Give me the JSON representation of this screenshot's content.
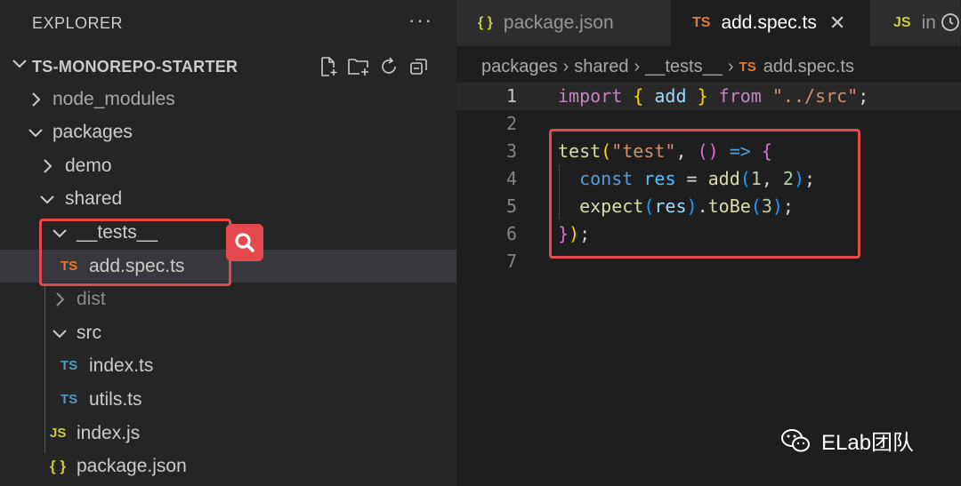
{
  "explorer": {
    "title": "EXPLORER",
    "more_label": "···",
    "project_name": "TS-MONOREPO-STARTER",
    "actions": [
      "new-file-icon",
      "new-folder-icon",
      "refresh-icon",
      "collapse-all-icon"
    ],
    "tree": [
      {
        "label": "node_modules",
        "kind": "folder",
        "expanded": false,
        "dim": false
      },
      {
        "label": "packages",
        "kind": "folder",
        "expanded": true
      },
      {
        "label": "demo",
        "kind": "folder",
        "expanded": false
      },
      {
        "label": "shared",
        "kind": "folder",
        "expanded": true
      },
      {
        "label": "__tests__",
        "kind": "folder",
        "expanded": true
      },
      {
        "label": "add.spec.ts",
        "kind": "file",
        "icon_text": "TS",
        "selected": true
      },
      {
        "label": "dist",
        "kind": "folder",
        "expanded": false,
        "dim": true
      },
      {
        "label": "src",
        "kind": "folder",
        "expanded": true
      },
      {
        "label": "index.ts",
        "kind": "file",
        "icon_text": "TS"
      },
      {
        "label": "utils.ts",
        "kind": "file",
        "icon_text": "TS"
      },
      {
        "label": "index.js",
        "kind": "file",
        "icon_text": "JS"
      },
      {
        "label": "package.json",
        "kind": "file",
        "icon_text": "{ }"
      }
    ]
  },
  "tabs": [
    {
      "label": "package.json",
      "icon_text": "{ }",
      "active": false
    },
    {
      "label": "add.spec.ts",
      "icon_text": "TS",
      "active": true,
      "close": "✕"
    },
    {
      "label": "in",
      "icon_text": "JS",
      "active": false
    }
  ],
  "breadcrumb": {
    "parts": [
      "packages",
      "shared",
      "__tests__"
    ],
    "file_icon_text": "TS",
    "file": "add.spec.ts",
    "separator": "›"
  },
  "code": {
    "line_numbers": [
      "1",
      "2",
      "3",
      "4",
      "5",
      "6",
      "7"
    ]
  },
  "watermark": {
    "text": "ELab团队"
  },
  "colors": {
    "highlight": "#e5484d",
    "ts_orange": "#e37933",
    "ts_blue": "#519aba",
    "js_yellow": "#cbcb41"
  }
}
